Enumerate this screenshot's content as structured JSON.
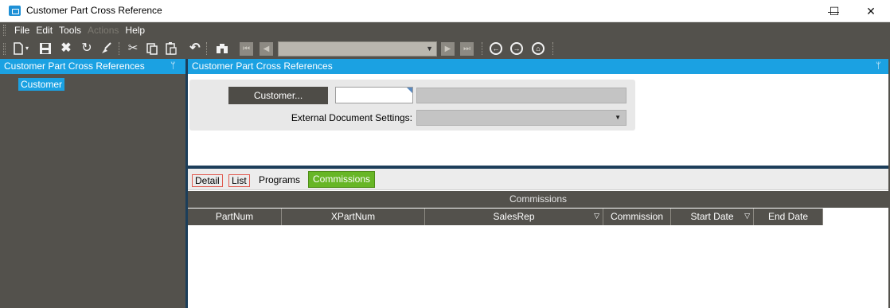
{
  "window": {
    "title": "Customer Part Cross Reference",
    "minimize_glyph": "—",
    "maximize_glyph": "☐",
    "close_glyph": "✕"
  },
  "menu": {
    "items": [
      {
        "label": "File",
        "enabled": true
      },
      {
        "label": "Edit",
        "enabled": true
      },
      {
        "label": "Tools",
        "enabled": true
      },
      {
        "label": "Actions",
        "enabled": false
      },
      {
        "label": "Help",
        "enabled": true
      }
    ]
  },
  "toolbar": {
    "icons": [
      "new-icon",
      "save-icon",
      "delete-icon",
      "refresh-icon",
      "clear-icon",
      "cut-icon",
      "copy-icon",
      "paste-icon",
      "undo-icon",
      "search-icon",
      "first-record-icon",
      "previous-record-icon",
      "next-record-icon",
      "last-record-icon",
      "back-icon",
      "forward-icon",
      "home-icon"
    ],
    "navigator_value": ""
  },
  "tree_panel": {
    "title": "Customer Part Cross References",
    "pin_glyph": "ᛘ",
    "nodes": [
      {
        "label": "Customer",
        "selected": true
      }
    ]
  },
  "detail_panel": {
    "title": "Customer Part Cross References",
    "pin_glyph": "ᛘ",
    "customer_button_label": "Customer...",
    "customer_id_value": "",
    "customer_name_value": "",
    "external_doc_label": "External Document Settings:",
    "external_doc_value": ""
  },
  "tabs": [
    {
      "label": "Detail",
      "active": false,
      "outlined": true
    },
    {
      "label": "List",
      "active": false,
      "outlined": true
    },
    {
      "label": "Programs",
      "active": false,
      "outlined": false
    },
    {
      "label": "Commissions",
      "active": true,
      "outlined": false
    }
  ],
  "grid": {
    "title": "Commissions",
    "columns": [
      {
        "label": "PartNum",
        "filter": false
      },
      {
        "label": "XPartNum",
        "filter": false
      },
      {
        "label": "SalesRep",
        "filter": true
      },
      {
        "label": "Commission",
        "filter": false
      },
      {
        "label": "Start Date",
        "filter": true
      },
      {
        "label": "End Date",
        "filter": false
      }
    ],
    "rows": []
  },
  "colors": {
    "accent": "#1ba1e2",
    "dark_chrome": "#53514c",
    "active_tab": "#67b626",
    "tab_outline": "#e05a4f"
  }
}
